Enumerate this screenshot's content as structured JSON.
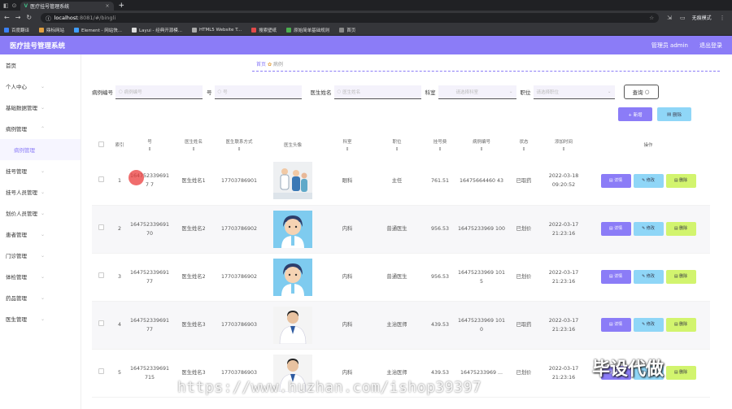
{
  "browser": {
    "tab_title": "医疗挂号管理系统",
    "url_host": "localhost",
    "url_path": ":8081/#/bingli",
    "account": "无痕模式",
    "bookmarks": [
      "百度翻译",
      "鼎标网站",
      "Element - 网站快...",
      "Layui - 经典开源模...",
      "HTML5 Website T...",
      "搜索壁纸",
      "原始简单基础规则",
      "首页"
    ]
  },
  "header": {
    "title": "医疗挂号管理系统",
    "user": "管理员 admin",
    "logout": "退出登录",
    "color": "#8b7cf7"
  },
  "sidebar": {
    "items": [
      {
        "label": "首页"
      },
      {
        "label": "个人中心"
      },
      {
        "label": "基础数据管理"
      },
      {
        "label": "病例管理"
      },
      {
        "label": "病例管理"
      },
      {
        "label": "挂号管理"
      },
      {
        "label": "挂号人员管理"
      },
      {
        "label": "划价人员管理"
      },
      {
        "label": "患者管理"
      },
      {
        "label": "门诊管理"
      },
      {
        "label": "体检管理"
      },
      {
        "label": "药品管理"
      },
      {
        "label": "医生管理"
      }
    ]
  },
  "breadcrumb": {
    "home": "首页",
    "current": "病例"
  },
  "filters": {
    "case_no_label": "病例编号",
    "case_no_ph": "病例编号",
    "no_label": "号",
    "no_ph": "号",
    "doctor_label": "医生姓名",
    "doctor_ph": "医生姓名",
    "dept_label": "科室",
    "dept_ph": "请选择科室",
    "title_label": "职位",
    "title_ph": "请选择职位",
    "query": "查询"
  },
  "actions": {
    "add": "+ 新增",
    "delete": "删除"
  },
  "table": {
    "headers": [
      "索引",
      "号",
      "医生姓名",
      "医生联系方式",
      "医生头像",
      "科室",
      "职位",
      "挂号费",
      "病例编号",
      "状态",
      "添加时间",
      "操作"
    ],
    "rows": [
      {
        "idx": "1",
        "no": "1647523396917 7",
        "doctor": "医生姓名1",
        "phone": "17703786901",
        "dept": "眼科",
        "title": "主任",
        "fee": "761.51",
        "case": "16475664460 43",
        "status": "已取药",
        "time": "2022-03-18 09:20:52"
      },
      {
        "idx": "2",
        "no": "164752339691 70",
        "doctor": "医生姓名2",
        "phone": "17703786902",
        "dept": "内科",
        "title": "普通医生",
        "fee": "956.53",
        "case": "16475233969 100",
        "status": "已划价",
        "time": "2022-03-17 21:23:16"
      },
      {
        "idx": "3",
        "no": "164752339691 77",
        "doctor": "医生姓名2",
        "phone": "17703786902",
        "dept": "内科",
        "title": "普通医生",
        "fee": "956.53",
        "case": "16475233969 1015",
        "status": "已划价",
        "time": "2022-03-17 21:23:16"
      },
      {
        "idx": "4",
        "no": "164752339691 77",
        "doctor": "医生姓名3",
        "phone": "17703786903",
        "dept": "内科",
        "title": "主治医师",
        "fee": "439.53",
        "case": "16475233969 1010",
        "status": "已取药",
        "time": "2022-03-17 21:23:16"
      },
      {
        "idx": "5",
        "no": "164752339691 715",
        "doctor": "医生姓名3",
        "phone": "17703786903",
        "dept": "内科",
        "title": "主治医师",
        "fee": "439.53",
        "case": "16475233969 ...",
        "status": "已划价",
        "time": "2022-03-17 21:23:16"
      }
    ],
    "op_detail": "详情",
    "op_edit": "修改",
    "op_delete": "删除"
  },
  "watermark": {
    "url": "https://www.huzhan.com/ishop39397",
    "brand": "毕设代做"
  }
}
